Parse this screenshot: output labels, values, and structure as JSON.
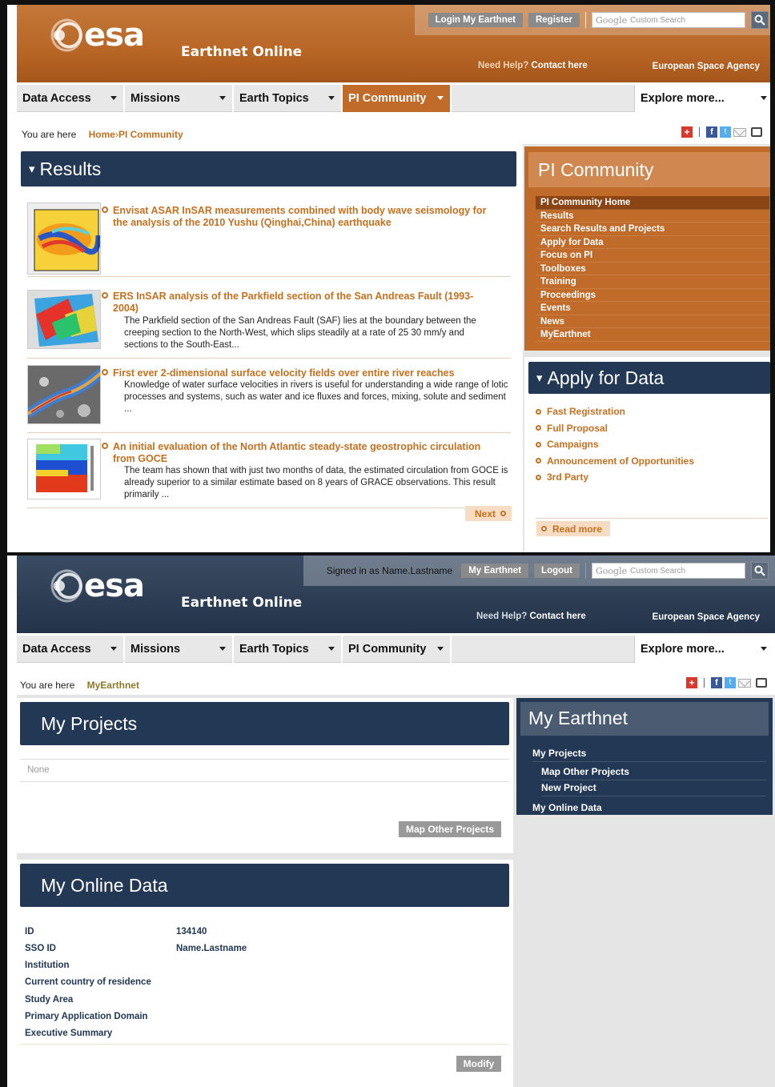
{
  "panel1": {
    "topbar": {
      "login_label": "Login My Earthnet",
      "register_label": "Register",
      "search_brand": "Google",
      "search_placeholder": "Custom Search"
    },
    "brand": {
      "logo_text": "esa",
      "site_name": "Earthnet Online"
    },
    "help": {
      "need_help": "Need Help?",
      "contact": "Contact here",
      "agency": "European Space Agency"
    },
    "nav": [
      {
        "label": "Data Access"
      },
      {
        "label": "Missions"
      },
      {
        "label": "Earth Topics"
      },
      {
        "label": "PI Community"
      },
      {
        "label": "Explore more..."
      }
    ],
    "breadcrumb": {
      "prefix": "You are here",
      "home": "Home",
      "sep": "›",
      "current": "PI Community"
    },
    "results": {
      "heading": "Results",
      "items": [
        {
          "title": "Envisat ASAR InSAR measurements combined with body wave seismology for the analysis of the 2010 Yushu (Qinghai,China) earthquake",
          "desc": ""
        },
        {
          "title": "ERS InSAR analysis of the Parkfield section of the San Andreas Fault (1993-2004)",
          "desc": "The Parkfield section of the San Andreas Fault (SAF) lies at the boundary between the creeping section to the North-West, which slips steadily at a rate of 25   30 mm/y and sections to the South-East..."
        },
        {
          "title": "First ever 2-dimensional surface velocity fields over entire river reaches",
          "desc": "Knowledge of water surface velocities in rivers is useful for understanding a wide range of lotic processes and systems, such as water and ice fluxes and forces, mixing, solute and sediment ..."
        },
        {
          "title": "An initial evaluation of the North Atlantic steady-state geostrophic circulation from GOCE",
          "desc": "The team has shown that with just two months of data, the estimated circulation from GOCE is already superior to a similar estimate based on 8 years of GRACE observations. This result primarily ..."
        }
      ],
      "next_label": "Next"
    },
    "pi_community": {
      "title": "PI Community",
      "items": [
        "PI Community Home",
        "Results",
        "Search Results and Projects",
        "Apply for Data",
        "Focus on PI",
        "Toolboxes",
        "Training",
        "Proceedings",
        "Events",
        "News",
        "MyEarthnet"
      ]
    },
    "apply": {
      "heading": "Apply for Data",
      "items": [
        "Fast Registration",
        "Full Proposal",
        "Campaigns",
        "Announcement of Opportunities",
        "3rd Party"
      ],
      "read_more": "Read more"
    }
  },
  "panel2": {
    "topbar": {
      "signed_in": "Signed in as Name.Lastname",
      "my_earthnet_label": "My Earthnet",
      "logout_label": "Logout",
      "search_brand": "Google",
      "search_placeholder": "Custom Search"
    },
    "brand": {
      "logo_text": "esa",
      "site_name": "Earthnet Online"
    },
    "help": {
      "need_help": "Need Help?",
      "contact": "Contact here",
      "agency": "European Space Agency"
    },
    "nav": [
      {
        "label": "Data Access"
      },
      {
        "label": "Missions"
      },
      {
        "label": "Earth Topics"
      },
      {
        "label": "PI Community"
      },
      {
        "label": "Explore more..."
      }
    ],
    "breadcrumb": {
      "prefix": "You are here",
      "current": "MyEarthnet"
    },
    "my_projects": {
      "heading": "My Projects",
      "empty": "None",
      "map_btn": "Map Other Projects"
    },
    "online_data": {
      "heading": "My Online Data",
      "rows": [
        {
          "label": "ID",
          "value": "134140"
        },
        {
          "label": "SSO ID",
          "value": "Name.Lastname"
        },
        {
          "label": "Institution",
          "value": ""
        },
        {
          "label": "Current country of residence",
          "value": ""
        },
        {
          "label": "Study Area",
          "value": ""
        },
        {
          "label": "Primary Application Domain",
          "value": ""
        },
        {
          "label": "Executive Summary",
          "value": ""
        }
      ],
      "modify_btn": "Modify"
    },
    "my_earthnet": {
      "title": "My Earthnet",
      "items": [
        "My Projects",
        "Map Other Projects",
        "New Project",
        "My Online Data"
      ]
    }
  },
  "colors": {
    "orange": "#c06b2a",
    "link_orange": "#c4701f",
    "navy": "#223854",
    "gray_button": "#8a8a8a"
  }
}
